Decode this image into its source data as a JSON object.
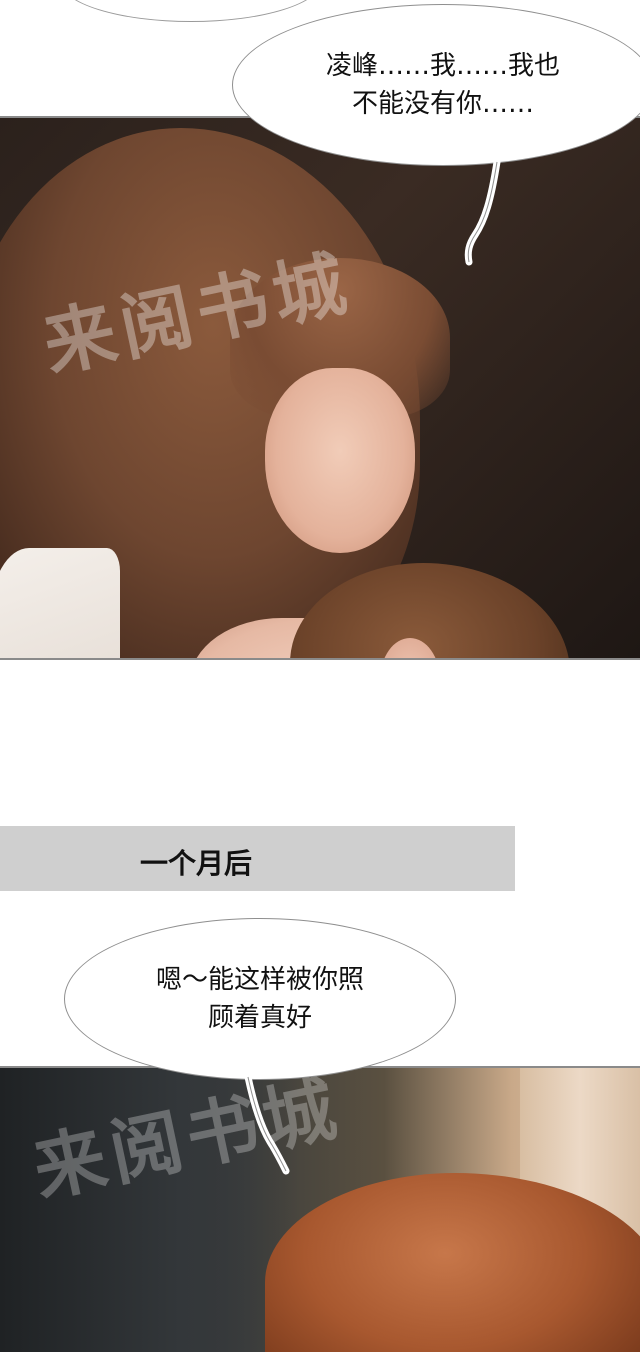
{
  "panels": {
    "panel1": {
      "speech": "凌峰……我……我也\n不能没有你……"
    },
    "caption": "一个月后",
    "panel2": {
      "speech": "嗯～能这样被你照\n顾着真好"
    }
  },
  "watermark": "来阅书城",
  "colors": {
    "caption_bar": "#cfcfcf",
    "bubble_border": "#8f8f8f",
    "panel_border": "#8a8a8a"
  }
}
